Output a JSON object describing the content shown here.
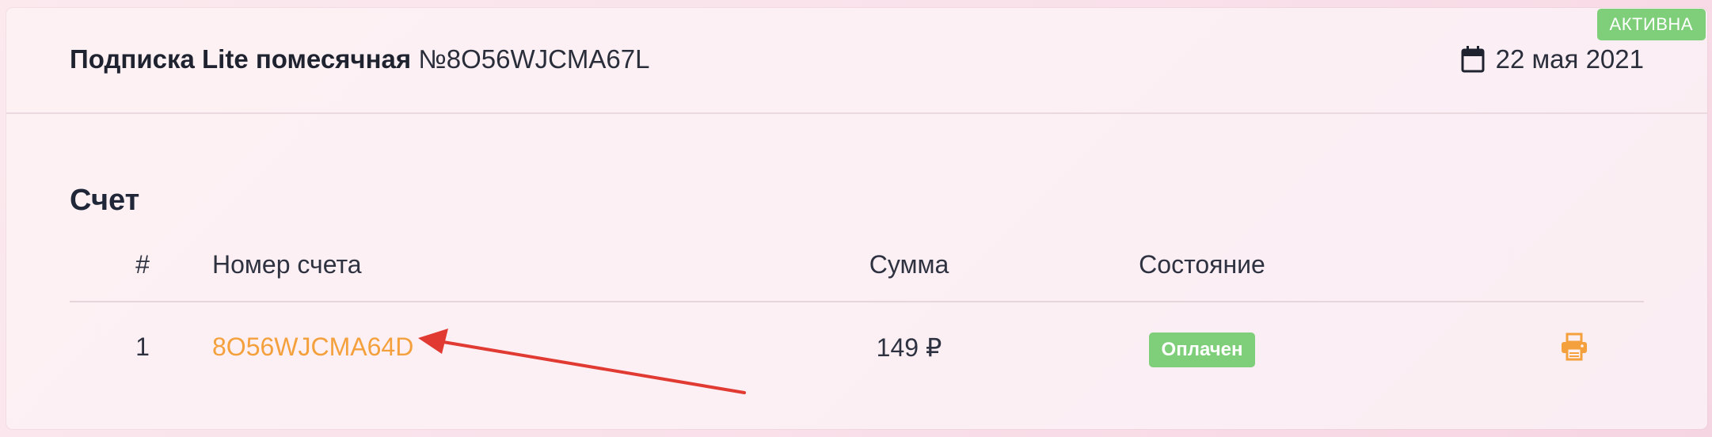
{
  "header": {
    "badge": "АКТИВНА",
    "title": "Подписка Lite помесячная",
    "number": "№8O56WJCMA67L",
    "date": "22 мая 2021",
    "calendar_icon": "calendar-icon"
  },
  "invoices": {
    "section_title": "Счет",
    "columns": {
      "num": "#",
      "invoice": "Номер счета",
      "sum": "Сумма",
      "state": "Состояние"
    },
    "rows": [
      {
        "num": "1",
        "invoice": "8O56WJCMA64D",
        "sum": "149 ₽",
        "state": "Оплачен",
        "print_icon": "print-icon"
      }
    ]
  },
  "colors": {
    "accent": "#f4a03d",
    "status_green": "#7fcf7a",
    "annotation_arrow": "#e03a33"
  }
}
